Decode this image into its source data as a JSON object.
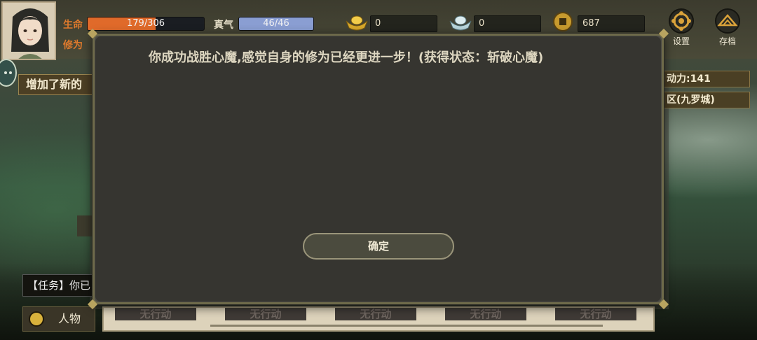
{
  "player": {
    "hp_label": "生命",
    "hp_value": "179/306",
    "hp_fraction": 0.585,
    "qi_label": "真气",
    "qi_value": "46/46",
    "qi_fraction": 1.0,
    "cultivation_label": "修为"
  },
  "currencies": [
    {
      "icon": "gold-ingot-icon",
      "value": "0"
    },
    {
      "icon": "silver-ingot-icon",
      "value": "0"
    },
    {
      "icon": "copper-coin-icon",
      "value": "687"
    }
  ],
  "top_buttons": {
    "settings": "设置",
    "save": "存档"
  },
  "left": {
    "notice": "增加了新的",
    "quest": "【任务】你已",
    "character_button": "人物"
  },
  "right": {
    "action_points": "动力:141",
    "location": "区(九罗城)"
  },
  "bottom_tabs": [
    "无行动",
    "无行动",
    "无行动",
    "无行动",
    "无行动"
  ],
  "dialog": {
    "message": "你成功战胜心魔,感觉自身的修为已经更进一步！(获得状态：斩破心魔)",
    "confirm": "确定"
  },
  "colors": {
    "hp_bar": "#e06a2a",
    "qi_bar": "#8a9ed2",
    "label_orange": "#e07a2c",
    "dialog_bg": "#4a4944"
  }
}
